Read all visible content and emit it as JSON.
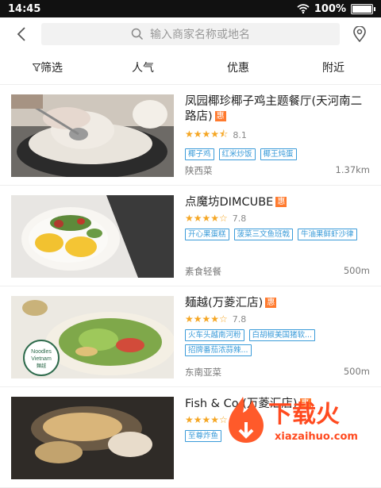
{
  "status": {
    "time": "14:45",
    "battery": "100%",
    "battery_level": 1.0
  },
  "search": {
    "placeholder": "输入商家名称或地名"
  },
  "filters": [
    {
      "label": "筛选",
      "icon": "filter-icon"
    },
    {
      "label": "人气"
    },
    {
      "label": "优惠"
    },
    {
      "label": "附近"
    }
  ],
  "restaurants": [
    {
      "name": "凤园椰珍椰子鸡主题餐厅(天河南二路店)",
      "badge": "惠",
      "stars": 4.5,
      "score": "8.1",
      "tags": [
        "椰子鸡",
        "红米炒饭",
        "椰王炖蛋"
      ],
      "cuisine": "陕西菜",
      "distance": "1.37km"
    },
    {
      "name": "点魔坊DIMCUBE",
      "badge": "惠",
      "stars": 4.0,
      "score": "7.8",
      "tags": [
        "开心果蛋糕",
        "菠菜三文鱼班戟",
        "牛油果鲜虾沙律"
      ],
      "cuisine": "素食轻餐",
      "distance": "500m"
    },
    {
      "name": "麺越(万菱汇店)",
      "badge": "惠",
      "stars": 4.0,
      "score": "7.8",
      "tags": [
        "火车头越南河粉",
        "白胡椒美国猪软...",
        "招牌番茄浓蒜辣..."
      ],
      "cuisine": "东南亚菜",
      "distance": "500m"
    },
    {
      "name": "Fish & Co (万菱汇店)",
      "badge": "惠",
      "stars": 4.0,
      "score": "",
      "tags": [
        "至尊炸鱼"
      ],
      "cuisine": "",
      "distance": ""
    }
  ],
  "thumb_text": {
    "logo_line1": "Noodles",
    "logo_line2": "Vietnam",
    "logo_line3": "麵越"
  },
  "watermark": {
    "brand": "下载火",
    "url": "xiazaihuo.com"
  },
  "colors": {
    "badge": "#ff7a2e",
    "tag": "#3a9bd9",
    "star": "#f5a623"
  }
}
